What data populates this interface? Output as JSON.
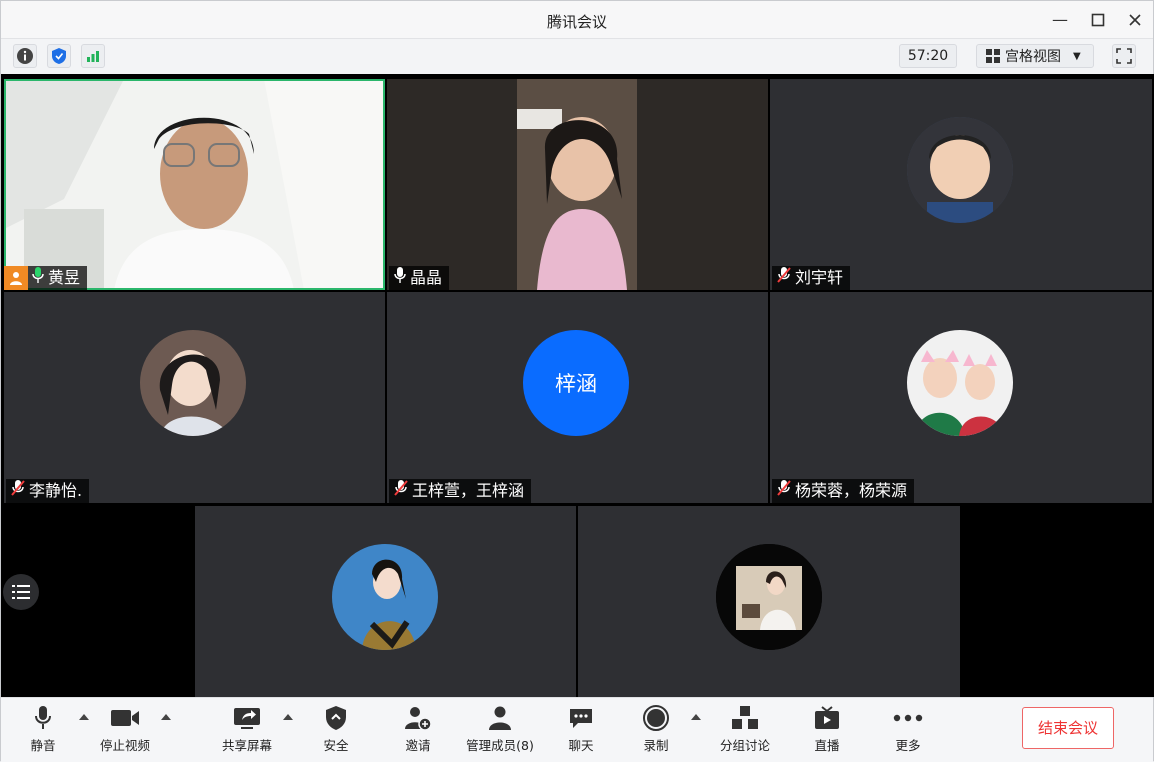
{
  "window": {
    "title": "腾讯会议"
  },
  "toolbar": {
    "timer": "57:20",
    "view_label": "宫格视图"
  },
  "participants": [
    {
      "name": "黄昱",
      "mic": "on",
      "host": true
    },
    {
      "name": "晶晶",
      "mic": "on"
    },
    {
      "name": "刘宇轩",
      "mic": "muted"
    },
    {
      "name": "李静怡.",
      "mic": "muted"
    },
    {
      "name": "王梓萱，王梓涵",
      "mic": "muted",
      "avatar_text": "梓涵"
    },
    {
      "name": "杨荣蓉，杨荣源",
      "mic": "muted"
    }
  ],
  "bottom": {
    "mute": "静音",
    "stop_video": "停止视频",
    "share": "共享屏幕",
    "security": "安全",
    "invite": "邀请",
    "members": "管理成员(8)",
    "chat": "聊天",
    "record": "录制",
    "breakout": "分组讨论",
    "live": "直播",
    "more": "更多",
    "end": "结束会议"
  },
  "colors": {
    "accent": "#0a6cff",
    "active_border": "#2bb66b",
    "end_red": "#e33333",
    "tile_bg": "#2e2f33"
  }
}
